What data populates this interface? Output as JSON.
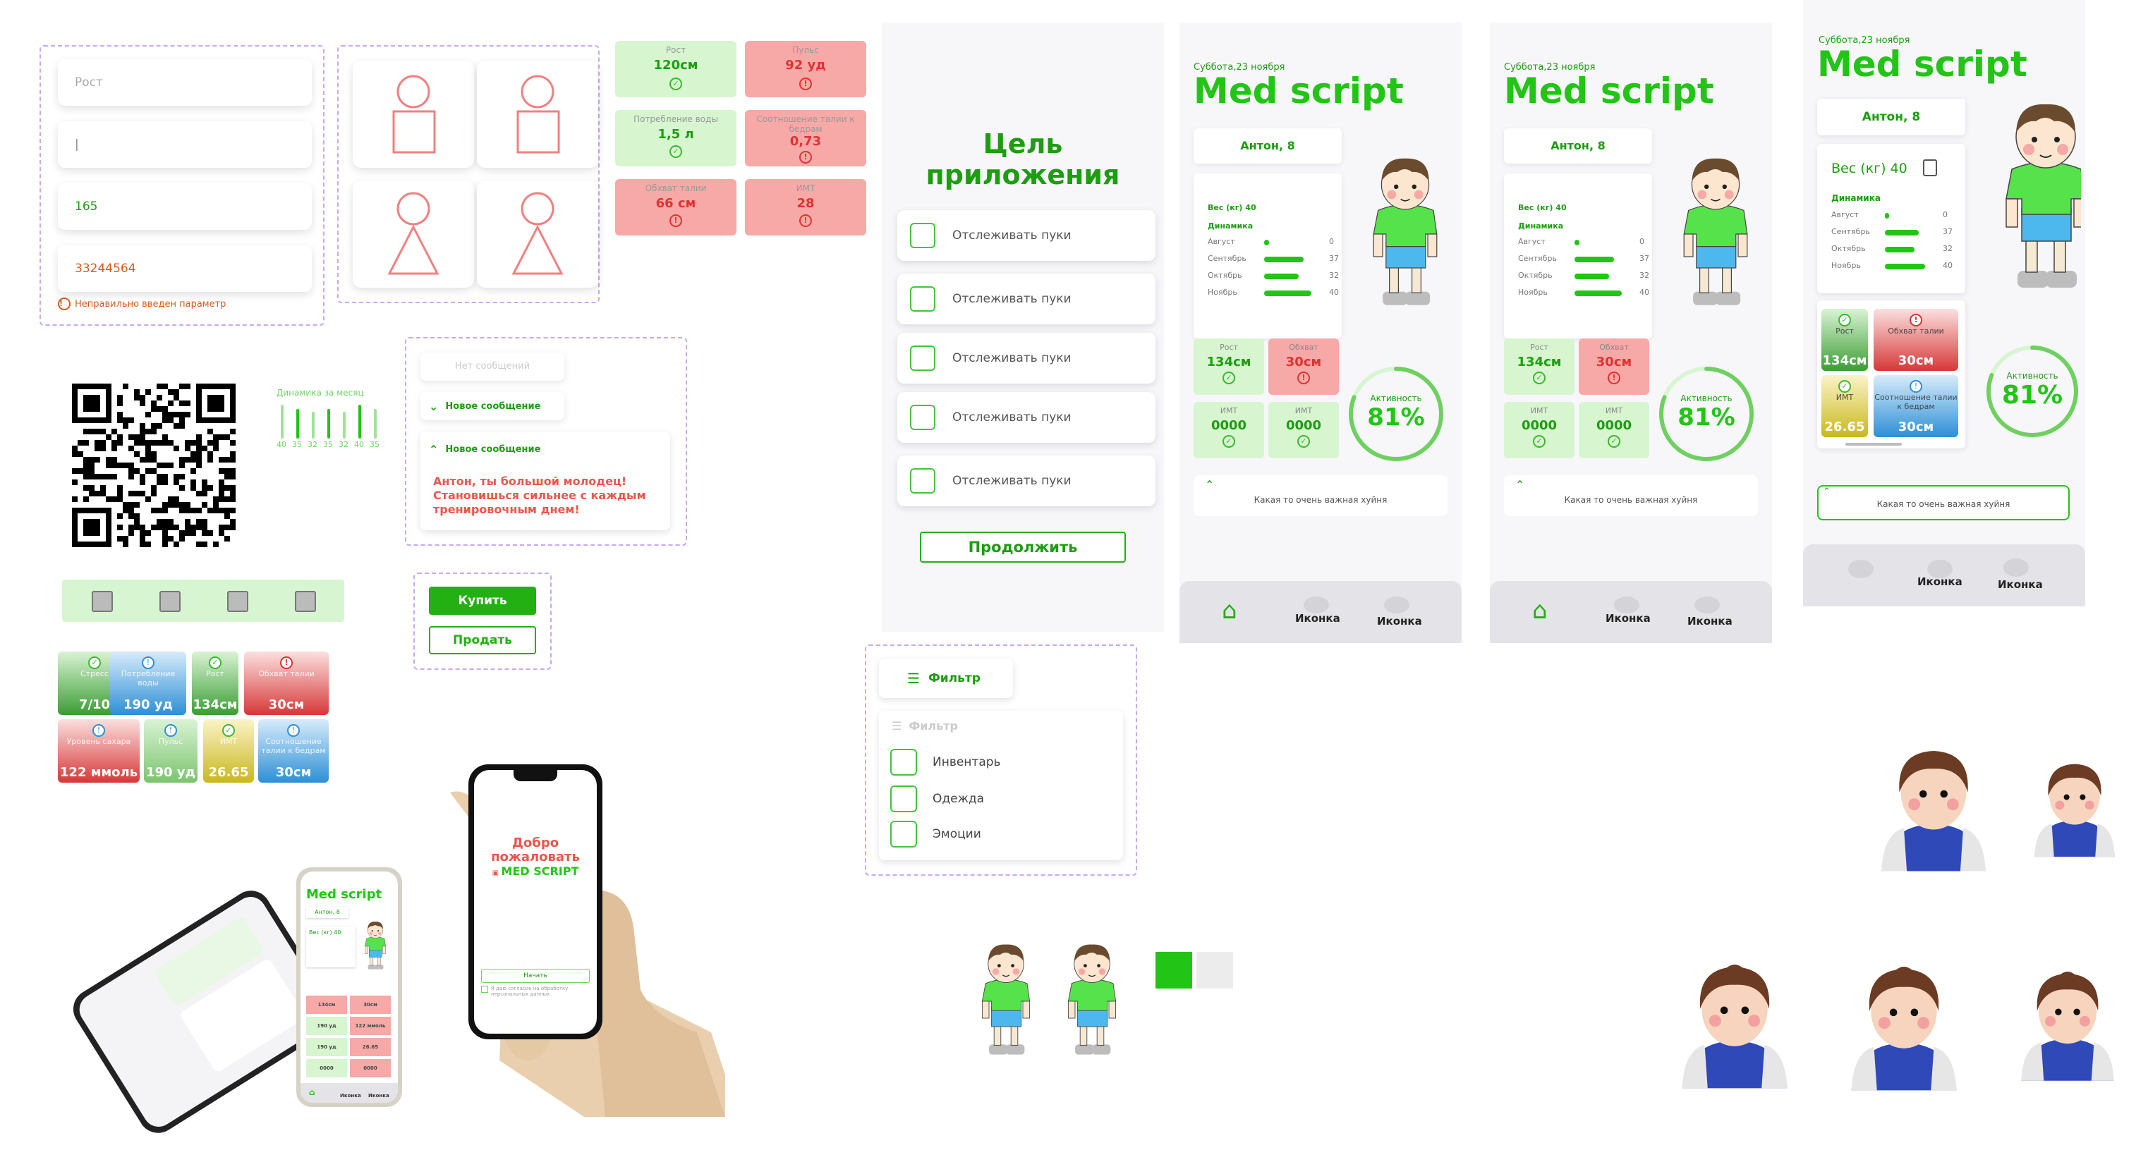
{
  "form": {
    "height_placeholder": "Рост",
    "cursor": "|",
    "height_value": "165",
    "error_value": "33244564",
    "error_message": "Неправильно введен параметр"
  },
  "stats_top": [
    {
      "label": "Рост",
      "value": "120см",
      "state": "ok"
    },
    {
      "label": "Пульс",
      "value": "92 уд",
      "state": "bad"
    },
    {
      "label": "Потребление воды",
      "value": "1,5 л",
      "state": "ok"
    },
    {
      "label": "Соотношение талии к бедрам",
      "value": "0,73",
      "state": "bad"
    },
    {
      "label": "Обхват талии",
      "value": "66 см",
      "state": "bad"
    },
    {
      "label": "ИМТ",
      "value": "28",
      "state": "bad"
    }
  ],
  "chart_mini": {
    "title": "Динамика за месяц",
    "values": [
      "40",
      "35",
      "32",
      "35",
      "32",
      "40",
      "35"
    ]
  },
  "messages": {
    "none": "Нет сообщений",
    "new1": "Новое сообщение",
    "new2": "Новое сообщение",
    "body": "Антон, ты большой молодец! Становишься сильнее с каждым тренировочным днем!"
  },
  "buttons": {
    "buy": "Купить",
    "sell": "Продать"
  },
  "gradient_cards": [
    {
      "label": "Стресс",
      "value": "7/10"
    },
    {
      "label": "Потребление воды",
      "value": "190 уд"
    },
    {
      "label": "Рост",
      "value": "134см"
    },
    {
      "label": "Обхват талии",
      "value": "30см"
    },
    {
      "label": "Уровень сахара",
      "value": "122 ммоль"
    },
    {
      "label": "Пульс",
      "value": "190 уд"
    },
    {
      "label": "ИМТ",
      "value": "26.65"
    },
    {
      "label": "Соотношение талии к бедрам",
      "value": "30см"
    }
  ],
  "goal_screen": {
    "title_line1": "Цель",
    "title_line2": "приложения",
    "options": [
      "Отслеживать пуки",
      "Отслеживать пуки",
      "Отслеживать пуки",
      "Отслеживать пуки",
      "Отслеживать пуки"
    ],
    "continue": "Продолжить"
  },
  "filter": {
    "button": "Фильтр",
    "ghost": "Фильтр",
    "items": [
      "Инвентарь",
      "Одежда",
      "Эмоции"
    ]
  },
  "welcome_phone": {
    "line1": "Добро",
    "line2": "пожаловать",
    "brand": "MED SCRIPT",
    "start": "Начать",
    "consent": "Я даю согласие на обработку персональных данных"
  },
  "main_screen": {
    "date": "Суббота,23 ноября",
    "title": "Med script",
    "user": "Антон, 8",
    "weight": "Вес (кг) 40",
    "dynamics": "Динамика",
    "months": [
      {
        "name": "Август",
        "value": "0",
        "fill": 0.1
      },
      {
        "name": "Сентябрь",
        "value": "37",
        "fill": 0.8
      },
      {
        "name": "Октябрь",
        "value": "32",
        "fill": 0.7
      },
      {
        "name": "Ноябрь",
        "value": "40",
        "fill": 0.95
      }
    ],
    "cards": [
      {
        "label": "Рост",
        "value": "134см",
        "state": "ok"
      },
      {
        "label": "Обхват",
        "value": "30см",
        "state": "bad"
      },
      {
        "label": "ИМТ",
        "value": "0000",
        "state": "ok"
      },
      {
        "label": "ИМТ",
        "value": "0000",
        "state": "ok"
      }
    ],
    "activity_label": "Активность",
    "activity": "81%",
    "activity_fraction": 0.81,
    "note": "Какая то очень важная хуйня",
    "nav_icon1": "Иконка",
    "nav_icon2": "Иконка"
  },
  "main_screen_v3": {
    "cards": [
      {
        "label": "Рост",
        "value": "134см"
      },
      {
        "label": "Обхват талии",
        "value": "30см"
      },
      {
        "label": "ИМТ",
        "value": "26.65"
      },
      {
        "label": "Соотношение талии к бедрам",
        "value": "30см"
      }
    ]
  },
  "mockup_phone": {
    "title": "Med script",
    "user": "Антон, 8",
    "weight": "Вес (кг) 40",
    "activity": "81%",
    "cards": [
      "134см",
      "30см",
      "190 уд",
      "122 ммоль",
      "190 уд",
      "26.65",
      "0000",
      "0000"
    ],
    "nav": [
      "Иконка",
      "Иконка"
    ]
  },
  "swatches": [
    "#22c515",
    "#ececec"
  ]
}
